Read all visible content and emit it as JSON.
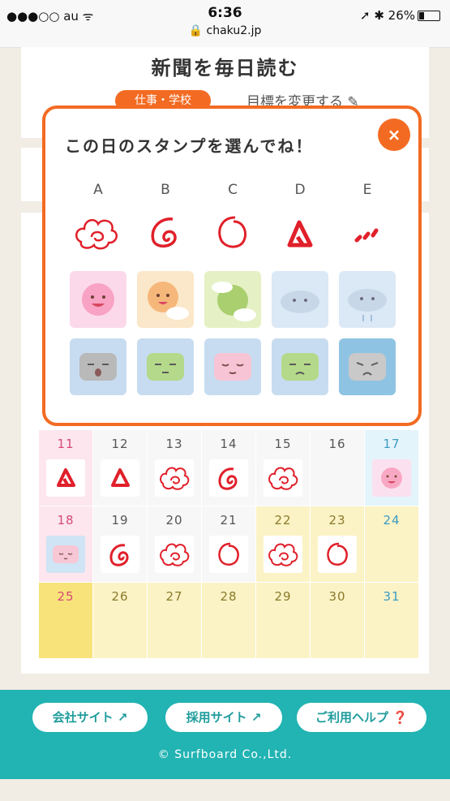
{
  "status_bar": {
    "carrier": "●●●○○ au ᯤ",
    "time": "6:36",
    "url": "🔒 chaku2.jp",
    "right": "➚ ✱ 26%"
  },
  "goal": {
    "title": "新聞を毎日読む",
    "category": "仕事・学校",
    "change_label": "目標を変更する ✎"
  },
  "modal": {
    "title": "この日のスタンプを選んでね！",
    "close_icon": "×",
    "columns": [
      "A",
      "B",
      "C",
      "D",
      "E"
    ],
    "hand_stamps": [
      "hanamaru-stamp",
      "spiral-stamp",
      "circle-stamp",
      "triangle-stamp",
      "dots-stamp"
    ],
    "weather_stamps": [
      "sunny-stamp",
      "sun-with-cloud-stamp",
      "sun-green-cloud-stamp",
      "cloudy-stamp",
      "rainy-cloud-stamp"
    ],
    "pillow_stamps": [
      "sleepy-pillow-stamp",
      "green-pillow-stamp",
      "pink-pillow-stamp",
      "sweat-pillow-stamp",
      "sad-pillow-stamp"
    ]
  },
  "calendar": {
    "weeks": [
      [
        {
          "day": "11",
          "stamp": "triangle"
        },
        {
          "day": "12",
          "stamp": "triangle"
        },
        {
          "day": "13",
          "stamp": "hanamaru"
        },
        {
          "day": "14",
          "stamp": "spiral"
        },
        {
          "day": "15",
          "stamp": "hanamaru"
        },
        {
          "day": "16",
          "stamp": ""
        },
        {
          "day": "17",
          "stamp": "sunny"
        }
      ],
      [
        {
          "day": "18",
          "stamp": "pillow"
        },
        {
          "day": "19",
          "stamp": "spiral"
        },
        {
          "day": "20",
          "stamp": "hanamaru"
        },
        {
          "day": "21",
          "stamp": "circle"
        },
        {
          "day": "22",
          "stamp": "hanamaru"
        },
        {
          "day": "23",
          "stamp": "circle"
        },
        {
          "day": "24",
          "stamp": ""
        }
      ],
      [
        {
          "day": "25",
          "stamp": ""
        },
        {
          "day": "26",
          "stamp": ""
        },
        {
          "day": "27",
          "stamp": ""
        },
        {
          "day": "28",
          "stamp": ""
        },
        {
          "day": "29",
          "stamp": ""
        },
        {
          "day": "30",
          "stamp": ""
        },
        {
          "day": "31",
          "stamp": ""
        }
      ]
    ]
  },
  "footer": {
    "company_site": "会社サイト ↗",
    "recruit_site": "採用サイト ↗",
    "help": "ご利用ヘルプ ❓",
    "copyright": "© Surfboard Co.,Ltd."
  },
  "colors": {
    "accent": "#f36b22",
    "footer": "#22b3b3",
    "stamp_red": "#e0202a"
  }
}
